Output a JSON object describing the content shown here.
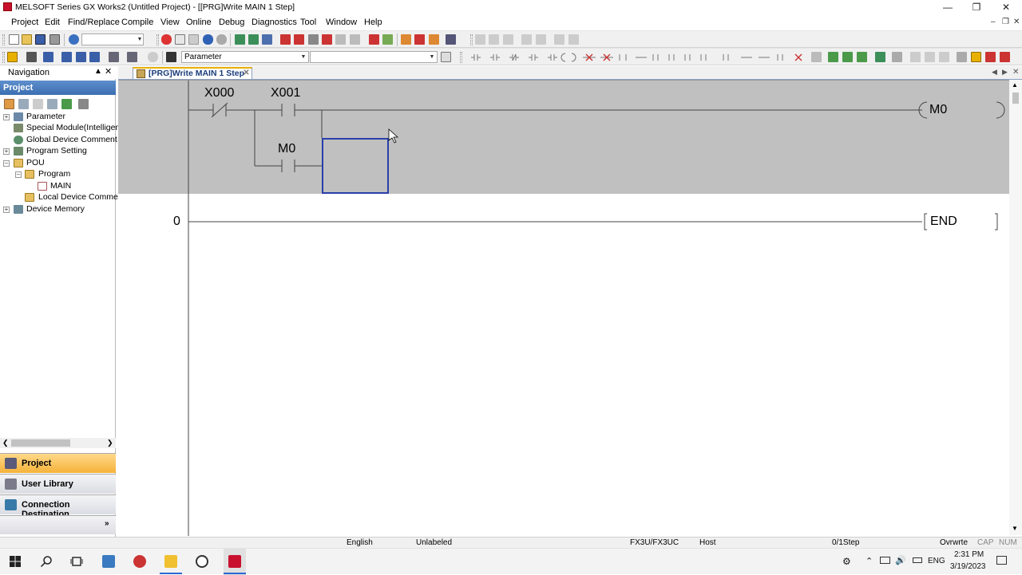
{
  "window": {
    "title": "MELSOFT Series GX Works2 (Untitled Project) - [[PRG]Write MAIN 1 Step]",
    "minimize_icon": "minimize-icon",
    "restore_icon": "restore-icon",
    "close_icon": "close-icon"
  },
  "menu": [
    "Project",
    "Edit",
    "Find/Replace",
    "Compile",
    "View",
    "Online",
    "Debug",
    "Diagnostics",
    "Tool",
    "Window",
    "Help"
  ],
  "toolbar": {
    "combo_empty": "",
    "parameter_combo": "Parameter",
    "second_combo": ""
  },
  "navigation": {
    "title": "Navigation",
    "pin_icon": "pin-icon",
    "close_icon": "close-icon",
    "project_header": "Project",
    "tree": [
      {
        "label": "Parameter"
      },
      {
        "label": "Special Module(Intelligent"
      },
      {
        "label": "Global Device Comment"
      },
      {
        "label": "Program Setting"
      },
      {
        "label": "POU"
      },
      {
        "label": "Program"
      },
      {
        "label": "MAIN"
      },
      {
        "label": "Local Device Commen"
      },
      {
        "label": "Device Memory"
      }
    ],
    "bottom_buttons": [
      "Project",
      "User Library",
      "Connection Destination"
    ]
  },
  "tab": {
    "label": "[PRG]Write MAIN 1 Step"
  },
  "ladder": {
    "contact1": "X000",
    "contact2": "X001",
    "contact3": "M0",
    "coil": "M0",
    "step": "0",
    "end_instruction": "END"
  },
  "status": {
    "language": "English",
    "label_mode": "Unlabeled",
    "cpu": "FX3U/FX3UC",
    "connection": "Host",
    "steps": "0/1Step",
    "overwrite": "Ovrwrte",
    "cap": "CAP",
    "num": "NUM"
  },
  "taskbar": {
    "language": "ENG",
    "time": "2:31 PM",
    "date": "3/19/2023"
  }
}
